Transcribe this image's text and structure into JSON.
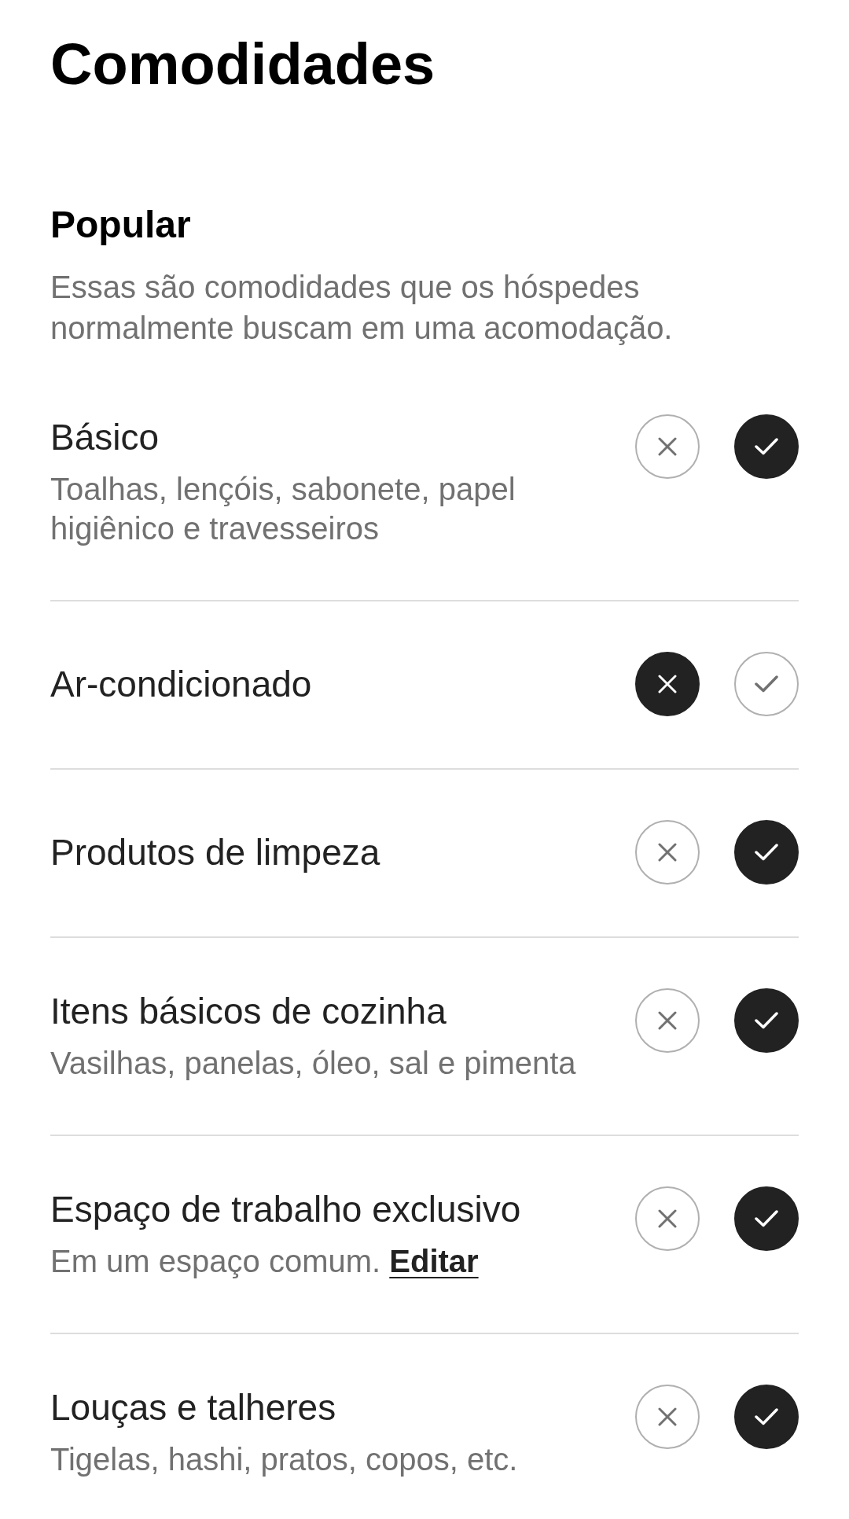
{
  "title": "Comodidades",
  "section": {
    "heading": "Popular",
    "description": "Essas são comodidades que os hóspedes normalmente buscam em uma acomodação."
  },
  "amenities": [
    {
      "name": "Básico",
      "description": "Toalhas, lençóis, sabonete, papel higiênico e travesseiros",
      "options": [
        {
          "kind": "no",
          "selected": false
        },
        {
          "kind": "yes",
          "selected": true
        }
      ]
    },
    {
      "name": "Ar-condicionado",
      "options": [
        {
          "kind": "no",
          "selected": true
        },
        {
          "kind": "yes",
          "selected": false
        }
      ]
    },
    {
      "name": "Produtos de limpeza",
      "options": [
        {
          "kind": "no",
          "selected": false
        },
        {
          "kind": "yes",
          "selected": true
        }
      ]
    },
    {
      "name": "Itens básicos de cozinha",
      "description": "Vasilhas, panelas, óleo, sal e pimenta",
      "options": [
        {
          "kind": "no",
          "selected": false
        },
        {
          "kind": "yes",
          "selected": true
        }
      ]
    },
    {
      "name": "Espaço de trabalho exclusivo",
      "description": "Em um espaço comum.",
      "link": "Editar",
      "options": [
        {
          "kind": "no",
          "selected": false
        },
        {
          "kind": "yes",
          "selected": true
        }
      ]
    },
    {
      "name": "Louças e talheres",
      "description": "Tigelas, hashi, pratos, copos, etc.",
      "options": [
        {
          "kind": "no",
          "selected": false
        },
        {
          "kind": "yes",
          "selected": true
        }
      ]
    }
  ]
}
